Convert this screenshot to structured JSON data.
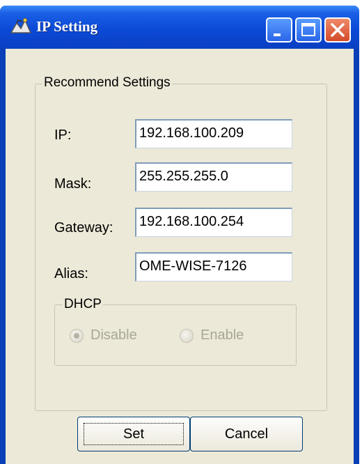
{
  "window": {
    "title": "IP Setting",
    "icon": "network-wizard-icon",
    "controls": [
      "minimize-icon",
      "maximize-icon",
      "close-icon"
    ]
  },
  "settings_group": {
    "label": "Recommend Settings",
    "fields": [
      {
        "label": "IP:",
        "value": "192.168.100.209"
      },
      {
        "label": "Mask:",
        "value": "255.255.255.0"
      },
      {
        "label": "Gateway:",
        "value": "192.168.100.254"
      },
      {
        "label": "Alias:",
        "value": "OME-WISE-7126"
      }
    ]
  },
  "dhcp_group": {
    "label": "DHCP",
    "options": [
      {
        "label": "Disable",
        "checked": true,
        "disabled": true
      },
      {
        "label": "Enable",
        "checked": false,
        "disabled": true
      }
    ]
  },
  "buttons": {
    "set_label": "Set",
    "cancel_label": "Cancel"
  }
}
